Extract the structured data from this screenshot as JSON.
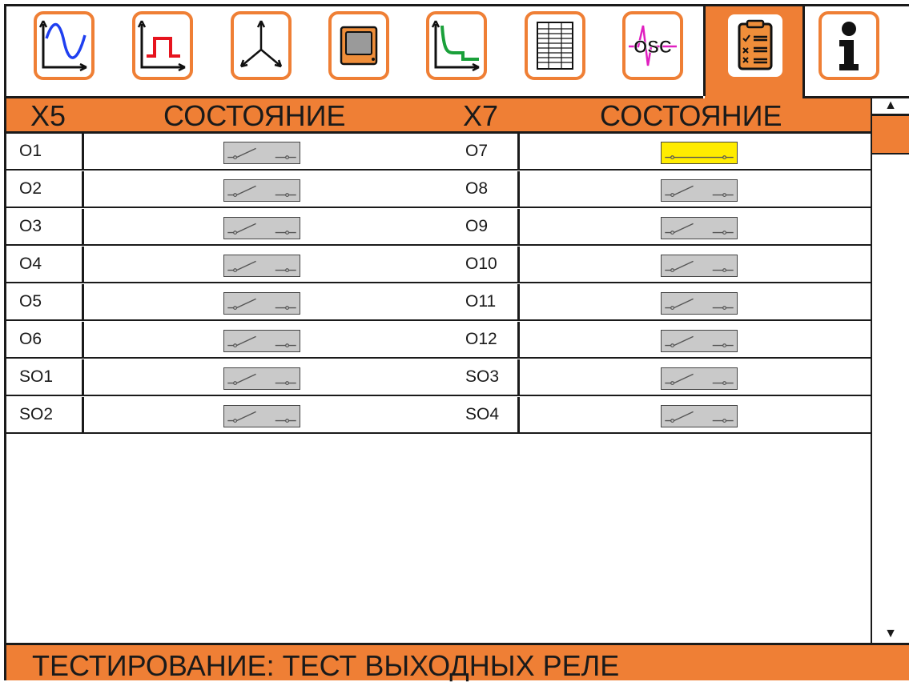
{
  "toolbar": {
    "tabs": [
      {
        "icon": "sine-wave-icon"
      },
      {
        "icon": "pulse-icon"
      },
      {
        "icon": "three-phase-vector-icon"
      },
      {
        "icon": "device-icon"
      },
      {
        "icon": "curve-icon"
      },
      {
        "icon": "table-icon"
      },
      {
        "icon": "oscilloscope-icon",
        "text": "OSC"
      },
      {
        "icon": "checklist-icon",
        "active": true
      },
      {
        "icon": "info-icon"
      }
    ],
    "accent": "#ef7f35"
  },
  "header": {
    "left_group": "X5",
    "left_state": "СОСТОЯНИЕ",
    "right_group": "X7",
    "right_state": "СОСТОЯНИЕ"
  },
  "rows": [
    {
      "left": "O1",
      "left_on": false,
      "right": "O7",
      "right_on": true
    },
    {
      "left": "O2",
      "left_on": false,
      "right": "O8",
      "right_on": false
    },
    {
      "left": "O3",
      "left_on": false,
      "right": "O9",
      "right_on": false
    },
    {
      "left": "O4",
      "left_on": false,
      "right": "O10",
      "right_on": false
    },
    {
      "left": "O5",
      "left_on": false,
      "right": "O11",
      "right_on": false
    },
    {
      "left": "O6",
      "left_on": false,
      "right": "O12",
      "right_on": false
    },
    {
      "left": "SO1",
      "left_on": false,
      "right": "SO3",
      "right_on": false
    },
    {
      "left": "SO2",
      "left_on": false,
      "right": "SO4",
      "right_on": false
    }
  ],
  "status": {
    "text": "ТЕСТИРОВАНИЕ: ТЕСТ ВЫХОДНЫХ РЕЛЕ"
  },
  "colors": {
    "accent": "#ef7f35",
    "relay_off": "#c9c9c9",
    "relay_on": "#ffec00"
  }
}
